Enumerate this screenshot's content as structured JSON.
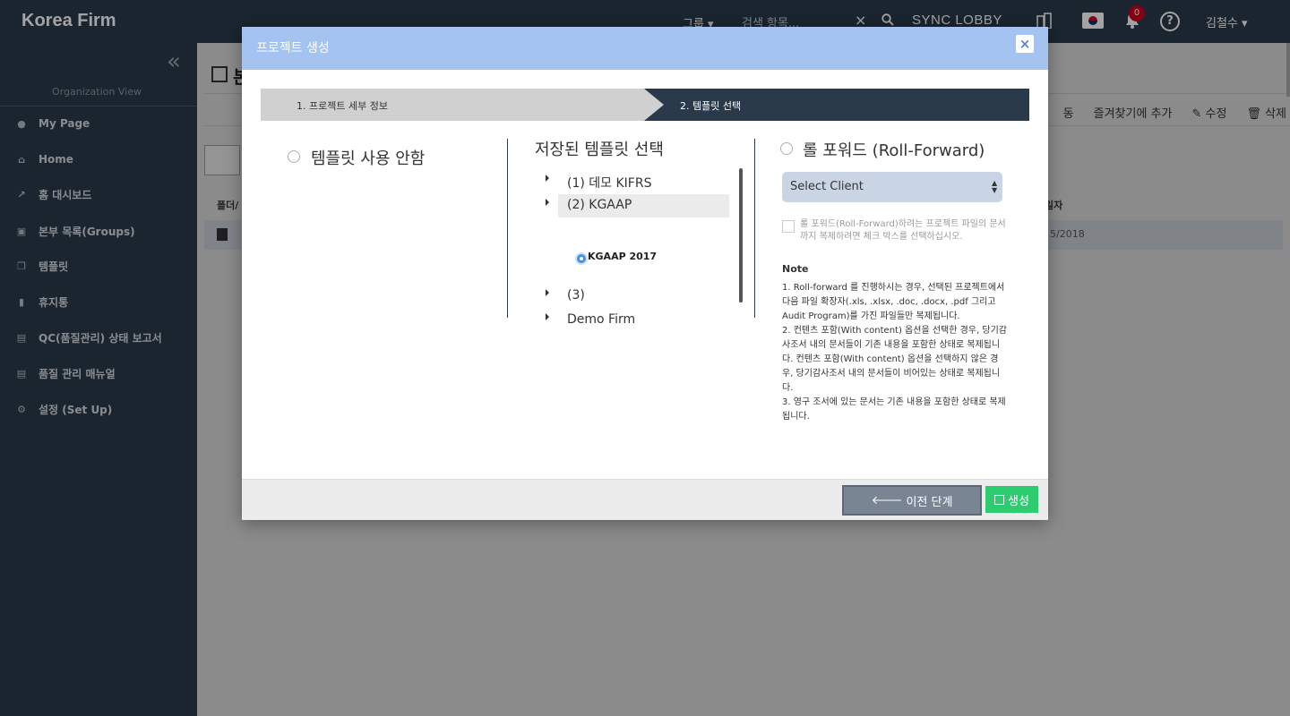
{
  "app": {
    "brand": "Korea Firm",
    "topbar": {
      "group_label": "그룹 ▾",
      "search_placeholder": "검색 항목...",
      "clear_icon": "×",
      "sync_label": "SYNC LOBBY",
      "notification_count": "0",
      "help_label": "?",
      "user_name": "김철수 ▾"
    },
    "sidebar": {
      "org_view": "Organization View",
      "items": [
        {
          "label": "My Page",
          "icon": "user-icon"
        },
        {
          "label": "Home",
          "icon": "home-icon"
        },
        {
          "label": "홈 대시보드",
          "icon": "chart-icon"
        },
        {
          "label": "본부 목록(Groups)",
          "icon": "building-icon"
        },
        {
          "label": "템플릿",
          "icon": "copy-icon"
        },
        {
          "label": "휴지통",
          "icon": "trash-icon"
        },
        {
          "label": "QC(품질관리) 상태 보고서",
          "icon": "report-icon"
        },
        {
          "label": "품질 관리 매뉴얼",
          "icon": "manual-icon"
        },
        {
          "label": "설정 (Set Up)",
          "icon": "gear-icon"
        }
      ]
    },
    "main": {
      "title": "본",
      "toolbar": [
        "동",
        "즐겨찾기에 추가",
        "✎ 수정",
        "🗑 삭제"
      ],
      "col_left": "폴더/",
      "col_right": "일자",
      "row_date": "5/2018"
    }
  },
  "modal": {
    "title": "프로젝트 생성",
    "close_label": "×",
    "steps": [
      "1. 프로젝트 세부 정보",
      "2. 템플릿 선택"
    ],
    "no_template_label": "템플릿 사용 안함",
    "saved_templates_title": "저장된 템플릿 선택",
    "tree": [
      {
        "label": "(1) 데모 KIFRS",
        "selected": false
      },
      {
        "label": "(2) KGAAP",
        "selected": true
      },
      {
        "label": "(3)",
        "selected": false
      },
      {
        "label": "Demo Firm",
        "selected": false
      }
    ],
    "tree_leaf": "KGAAP 2017",
    "roll_forward_label": "롤 포워드 (Roll-Forward)",
    "select_client": "Select Client",
    "checkbox_text": "롤 포워드(Roll-Forward)하려는 프로젝트 파일의 문서까지 복제하려면 체크 박스를 선택하십시오.",
    "note_title": "Note",
    "notes": [
      "1. Roll-forward 를 진행하시는 경우, 선택된 프로젝트에서 다음 파일 확장자(.xls, .xlsx, .doc, .docx, .pdf 그리고 Audit Program)를 가진 파일들만 복제됩니다.",
      "2. 컨텐츠 포함(With content) 옵션을 선택한 경우, 당기감사조서 내의 문서들이 기존 내용을 포함한 상태로 복제됩니다. 컨텐츠 포함(With content) 옵션을 선택하지 않은 경우, 당기감사조서 내의 문서들이 비어있는 상태로 복제됩니다.",
      "3. 영구 조서에 있는 문서는 기존 내용을 포함한 상태로 복제됩니다."
    ],
    "btn_prev": "이전 단계",
    "btn_create": "생성",
    "colors": {
      "header": "#a4c3f0",
      "step_active": "#2b3a4a",
      "create": "#2ecc71"
    }
  }
}
